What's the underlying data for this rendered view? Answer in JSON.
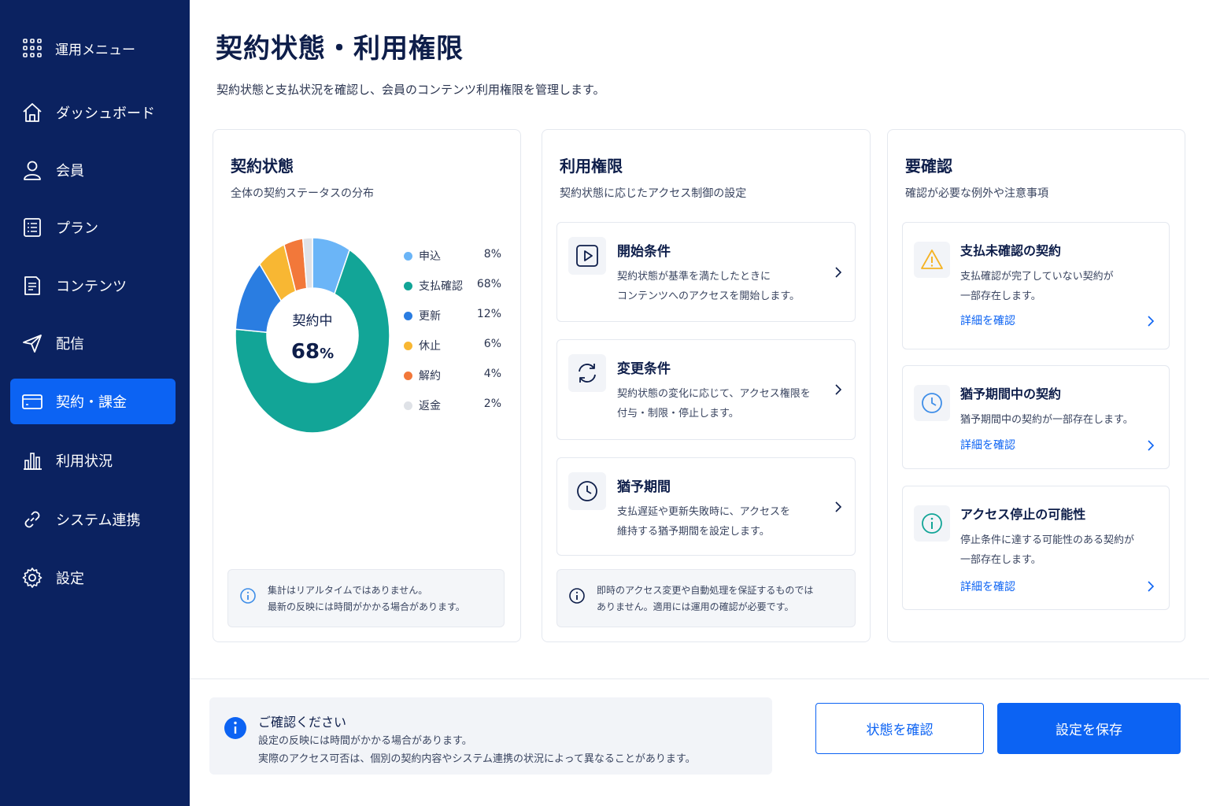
{
  "sidebar": {
    "menu_label": "運用メニュー",
    "items": [
      {
        "label": "ダッシュボード",
        "icon": "home-icon"
      },
      {
        "label": "会員",
        "icon": "user-icon"
      },
      {
        "label": "プラン",
        "icon": "plan-list-icon"
      },
      {
        "label": "コンテンツ",
        "icon": "document-icon"
      },
      {
        "label": "配信",
        "icon": "send-icon"
      },
      {
        "label": "契約・課金",
        "icon": "card-icon",
        "active": true
      },
      {
        "label": "利用状況",
        "icon": "bar-chart-icon"
      },
      {
        "label": "システム連携",
        "icon": "link-icon"
      },
      {
        "label": "設定",
        "icon": "gear-icon"
      }
    ]
  },
  "header": {
    "title": "契約状態・利用権限",
    "subtitle": "契約状態と支払状況を確認し、会員のコンテンツ利用権限を管理します。"
  },
  "contract_card": {
    "title": "契約状態",
    "subtitle": "全体の契約ステータスの分布",
    "center_label": "契約中",
    "center_value": "68",
    "center_unit": "%",
    "note_line1": "集計はリアルタイムではありません。",
    "note_line2": "最新の反映には時間がかかる場合があります。"
  },
  "chart_data": {
    "type": "pie",
    "categories": [
      "申込",
      "支払確認",
      "更新",
      "休止",
      "解約",
      "返金"
    ],
    "values": [
      8,
      68,
      12,
      6,
      4,
      2
    ],
    "value_labels": [
      "8%",
      "68%",
      "12%",
      "6%",
      "4%",
      "2%"
    ],
    "colors": [
      "#6bb5f7",
      "#12a597",
      "#2a7de1",
      "#f8b733",
      "#f2783a",
      "#dfe2e7"
    ],
    "legend_position": "right"
  },
  "permission_card": {
    "title": "利用権限",
    "subtitle": "契約状態に応じたアクセス制御の設定",
    "items": [
      {
        "title": "開始条件",
        "desc1": "契約状態が基準を満たしたときに",
        "desc2": "コンテンツへのアクセスを開始します。",
        "icon": "play-icon"
      },
      {
        "title": "変更条件",
        "desc1": "契約状態の変化に応じて、アクセス権限を",
        "desc2": "付与・制限・停止します。",
        "icon": "refresh-icon"
      },
      {
        "title": "猶予期間",
        "desc1": "支払遅延や更新失敗時に、アクセスを",
        "desc2": "維持する猶予期間を設定します。",
        "icon": "clock-icon"
      }
    ],
    "note_line1": "即時のアクセス変更や自動処理を保証するものでは",
    "note_line2": "ありません。適用には運用の確認が必要です。"
  },
  "review_card": {
    "title": "要確認",
    "subtitle": "確認が必要な例外や注意事項",
    "items": [
      {
        "title": "支払未確認の契約",
        "desc1": "支払確認が完了していない契約が",
        "desc2": "一部存在します。",
        "link": "詳細を確認",
        "icon": "warning-icon",
        "color": "#f5b324"
      },
      {
        "title": "猶予期間中の契約",
        "desc1": "猶予期間中の契約が一部存在します。",
        "desc2": "",
        "link": "詳細を確認",
        "icon": "clock-icon",
        "color": "#3f8ee8"
      },
      {
        "title": "アクセス停止の可能性",
        "desc1": "停止条件に達する可能性のある契約が",
        "desc2": "一部存在します。",
        "link": "詳細を確認",
        "icon": "info-icon",
        "color": "#12a597"
      }
    ]
  },
  "footer": {
    "note_title": "ご確認ください",
    "note_line1": "設定の反映には時間がかかる場合があります。",
    "note_line2": "実際のアクセス可否は、個別の契約内容やシステム連携の状況によって異なることがあります。",
    "secondary_button": "状態を確認",
    "primary_button": "設定を保存"
  },
  "colors": {
    "sidebar_bg": "#0b2260",
    "accent": "#0c63f3",
    "title_text": "#0e1e4a"
  }
}
